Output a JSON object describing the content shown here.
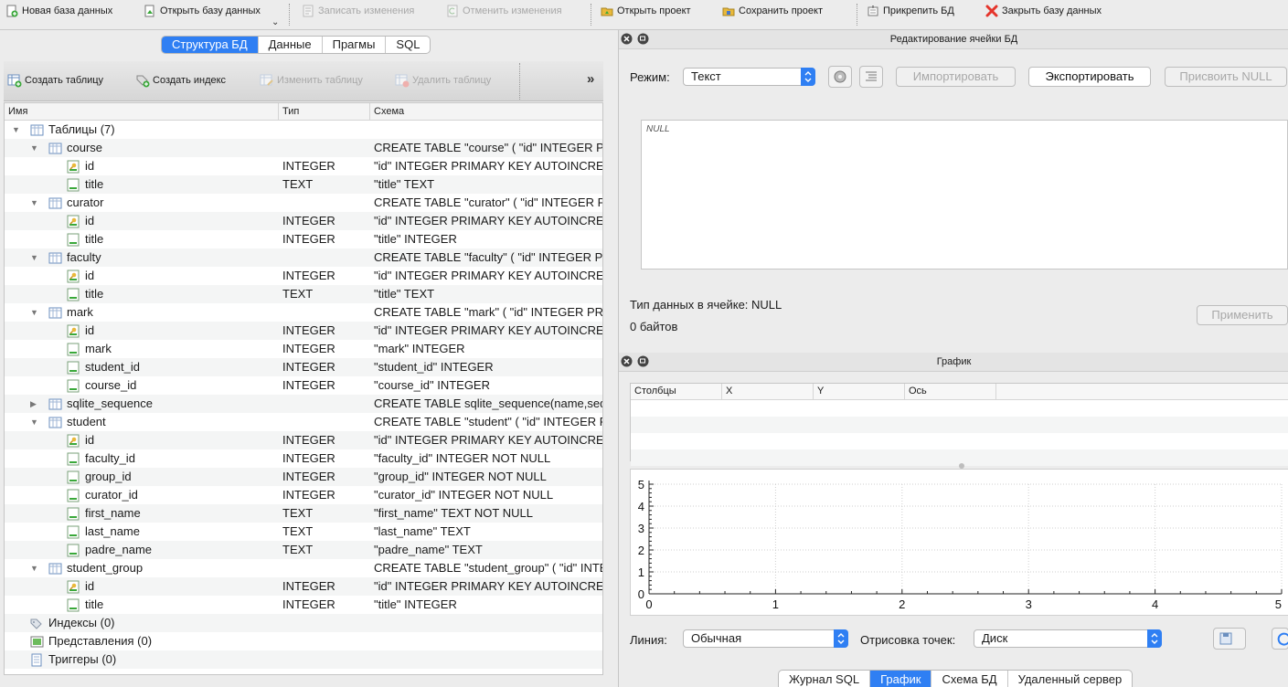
{
  "toolbar": {
    "new_db": "Новая база данных",
    "open_db": "Открыть базу данных",
    "write_changes": "Записать изменения",
    "revert_changes": "Отменить изменения",
    "open_project": "Открыть проект",
    "save_project": "Сохранить проект",
    "attach_db": "Прикрепить БД",
    "close_db": "Закрыть базу данных"
  },
  "left_tabs": [
    "Структура БД",
    "Данные",
    "Прагмы",
    "SQL"
  ],
  "structure_toolbar": {
    "create_table": "Создать таблицу",
    "create_index": "Создать индекс",
    "modify_table": "Изменить таблицу",
    "delete_table": "Удалить таблицу",
    "more": "»"
  },
  "tree": {
    "headers": [
      "Имя",
      "Тип",
      "Схема"
    ],
    "rows": [
      {
        "level": 0,
        "arrow": "open",
        "icon": "tables",
        "name": "Таблицы (7)",
        "type": "",
        "schema": ""
      },
      {
        "level": 1,
        "arrow": "open",
        "icon": "table",
        "name": "course",
        "type": "",
        "schema": "CREATE TABLE \"course\" ( \"id\" INTEGER PRIMARY KEY"
      },
      {
        "level": 2,
        "arrow": "",
        "icon": "key-field",
        "name": "id",
        "type": "INTEGER",
        "schema": "\"id\" INTEGER PRIMARY KEY AUTOINCREMENT"
      },
      {
        "level": 2,
        "arrow": "",
        "icon": "field",
        "name": "title",
        "type": "TEXT",
        "schema": "\"title\" TEXT"
      },
      {
        "level": 1,
        "arrow": "open",
        "icon": "table",
        "name": "curator",
        "type": "",
        "schema": "CREATE TABLE \"curator\" ( \"id\" INTEGER PRIMARY"
      },
      {
        "level": 2,
        "arrow": "",
        "icon": "key-field",
        "name": "id",
        "type": "INTEGER",
        "schema": "\"id\" INTEGER PRIMARY KEY AUTOINCREMENT"
      },
      {
        "level": 2,
        "arrow": "",
        "icon": "field",
        "name": "title",
        "type": "INTEGER",
        "schema": "\"title\" INTEGER"
      },
      {
        "level": 1,
        "arrow": "open",
        "icon": "table",
        "name": "faculty",
        "type": "",
        "schema": "CREATE TABLE \"faculty\" ( \"id\" INTEGER PRIMARY"
      },
      {
        "level": 2,
        "arrow": "",
        "icon": "key-field",
        "name": "id",
        "type": "INTEGER",
        "schema": "\"id\" INTEGER PRIMARY KEY AUTOINCREMENT"
      },
      {
        "level": 2,
        "arrow": "",
        "icon": "field",
        "name": "title",
        "type": "TEXT",
        "schema": "\"title\" TEXT"
      },
      {
        "level": 1,
        "arrow": "open",
        "icon": "table",
        "name": "mark",
        "type": "",
        "schema": "CREATE TABLE \"mark\" ( \"id\" INTEGER PRIMARY KEY"
      },
      {
        "level": 2,
        "arrow": "",
        "icon": "key-field",
        "name": "id",
        "type": "INTEGER",
        "schema": "\"id\" INTEGER PRIMARY KEY AUTOINCREMENT"
      },
      {
        "level": 2,
        "arrow": "",
        "icon": "field",
        "name": "mark",
        "type": "INTEGER",
        "schema": "\"mark\" INTEGER"
      },
      {
        "level": 2,
        "arrow": "",
        "icon": "field",
        "name": "student_id",
        "type": "INTEGER",
        "schema": "\"student_id\" INTEGER"
      },
      {
        "level": 2,
        "arrow": "",
        "icon": "field",
        "name": "course_id",
        "type": "INTEGER",
        "schema": "\"course_id\" INTEGER"
      },
      {
        "level": 1,
        "arrow": "closed",
        "icon": "table",
        "name": "sqlite_sequence",
        "type": "",
        "schema": "CREATE TABLE sqlite_sequence(name,seq)"
      },
      {
        "level": 1,
        "arrow": "open",
        "icon": "table",
        "name": "student",
        "type": "",
        "schema": "CREATE TABLE \"student\" ( \"id\" INTEGER PRIMARY"
      },
      {
        "level": 2,
        "arrow": "",
        "icon": "key-field",
        "name": "id",
        "type": "INTEGER",
        "schema": "\"id\" INTEGER PRIMARY KEY AUTOINCREMENT"
      },
      {
        "level": 2,
        "arrow": "",
        "icon": "field",
        "name": "faculty_id",
        "type": "INTEGER",
        "schema": "\"faculty_id\" INTEGER NOT NULL"
      },
      {
        "level": 2,
        "arrow": "",
        "icon": "field",
        "name": "group_id",
        "type": "INTEGER",
        "schema": "\"group_id\" INTEGER NOT NULL"
      },
      {
        "level": 2,
        "arrow": "",
        "icon": "field",
        "name": "curator_id",
        "type": "INTEGER",
        "schema": "\"curator_id\" INTEGER NOT NULL"
      },
      {
        "level": 2,
        "arrow": "",
        "icon": "field",
        "name": "first_name",
        "type": "TEXT",
        "schema": "\"first_name\" TEXT NOT NULL"
      },
      {
        "level": 2,
        "arrow": "",
        "icon": "field",
        "name": "last_name",
        "type": "TEXT",
        "schema": "\"last_name\" TEXT"
      },
      {
        "level": 2,
        "arrow": "",
        "icon": "field",
        "name": "padre_name",
        "type": "TEXT",
        "schema": "\"padre_name\" TEXT"
      },
      {
        "level": 1,
        "arrow": "open",
        "icon": "table",
        "name": "student_group",
        "type": "",
        "schema": "CREATE TABLE \"student_group\" ( \"id\" INTEGER"
      },
      {
        "level": 2,
        "arrow": "",
        "icon": "key-field",
        "name": "id",
        "type": "INTEGER",
        "schema": "\"id\" INTEGER PRIMARY KEY AUTOINCREMENT"
      },
      {
        "level": 2,
        "arrow": "",
        "icon": "field",
        "name": "title",
        "type": "INTEGER",
        "schema": "\"title\" INTEGER"
      },
      {
        "level": 0,
        "arrow": "",
        "icon": "indexes",
        "name": "Индексы (0)",
        "type": "",
        "schema": ""
      },
      {
        "level": 0,
        "arrow": "",
        "icon": "views",
        "name": "Представления (0)",
        "type": "",
        "schema": ""
      },
      {
        "level": 0,
        "arrow": "",
        "icon": "triggers",
        "name": "Триггеры (0)",
        "type": "",
        "schema": ""
      }
    ]
  },
  "edit_cell": {
    "title": "Редактирование ячейки БД",
    "mode_label": "Режим:",
    "mode_value": "Текст",
    "import_label": "Импортировать",
    "export_label": "Экспортировать",
    "set_null_label": "Присвоить NULL",
    "null_placeholder": "NULL",
    "type_info": "Тип данных в ячейке: NULL",
    "size_info": "0 байтов",
    "apply_label": "Применить"
  },
  "plot": {
    "title": "График",
    "columns_headers": [
      "Столбцы",
      "X",
      "Y",
      "Ось"
    ],
    "line_label": "Линия:",
    "line_value": "Обычная",
    "points_label": "Отрисовка точек:",
    "points_value": "Диск",
    "x_ticks": [
      "0",
      "1",
      "2",
      "3",
      "4",
      "5"
    ],
    "y_ticks": [
      "0",
      "1",
      "2",
      "3",
      "4",
      "5"
    ]
  },
  "bottom_tabs": [
    "Журнал SQL",
    "График",
    "Схема БД",
    "Удаленный сервер"
  ],
  "colors": {
    "accent": "#2f7ff3",
    "close_red": "#e5342b"
  }
}
